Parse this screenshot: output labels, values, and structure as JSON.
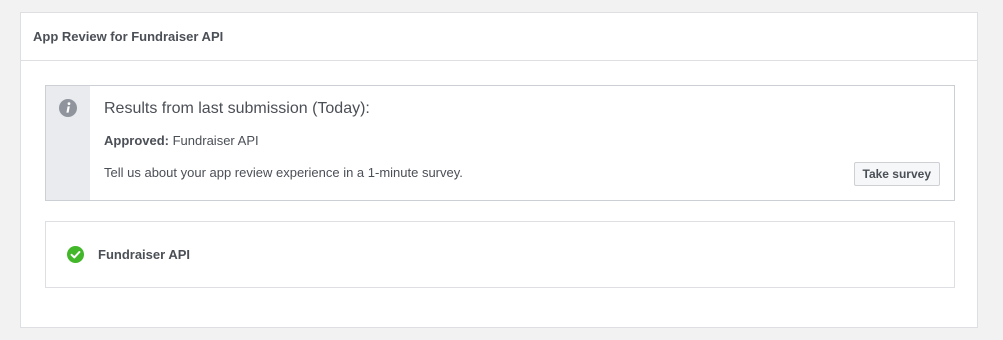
{
  "panel": {
    "title": "App Review for Fundraiser API"
  },
  "notice": {
    "icon": "info-icon",
    "heading": "Results from last submission (Today):",
    "approved_label": "Approved:",
    "approved_value": " Fundraiser API",
    "survey_text": "Tell us about your app review experience in a 1-minute survey.",
    "survey_button_label": "Take survey"
  },
  "permission": {
    "icon": "check-circle-icon",
    "name": "Fundraiser API",
    "status": "approved"
  },
  "colors": {
    "background": "#f2f2f2",
    "border": "#dddfe2",
    "gutter": "#e9ebee",
    "icon_gray": "#90949c",
    "success_green": "#42b72a",
    "text": "#4b4f56"
  }
}
